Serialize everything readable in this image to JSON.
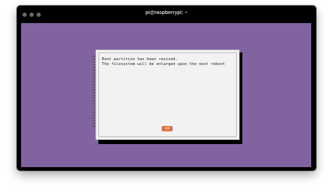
{
  "window": {
    "title": "pi@raspberrypi: ~"
  },
  "dialog": {
    "line1": "Root partition has been resized.",
    "line2": "The filesystem will be enlarged upon the next reboot",
    "ok_label": "<Ok>"
  },
  "colors": {
    "desktop": "#8163a1",
    "dialog_bg": "#f2f2f2",
    "button_accent": "#d45a5a"
  }
}
